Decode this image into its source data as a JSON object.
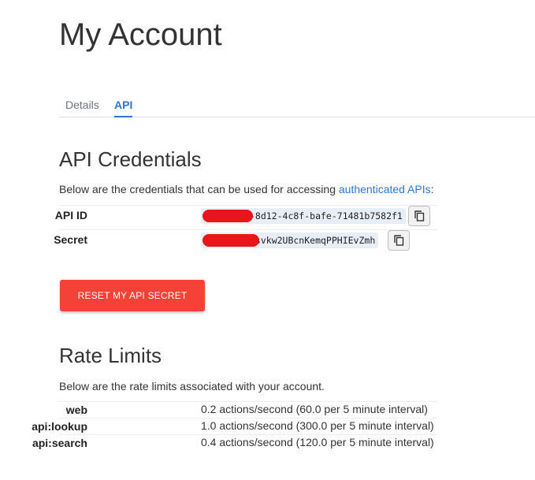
{
  "page": {
    "title": "My Account"
  },
  "tabs": [
    {
      "label": "Details",
      "active": false
    },
    {
      "label": "API",
      "active": true
    }
  ],
  "accent_color": "#2f74d6",
  "credentials": {
    "title": "API Credentials",
    "desc_prefix": "Below are the credentials that can be used for accessing ",
    "desc_link": "authenticated APIs",
    "desc_suffix": ":",
    "rows": [
      {
        "label": "API ID",
        "value": "-8d12-4c8f-bafe-71481b7582f1",
        "icon": "copy-icon"
      },
      {
        "label": "Secret",
        "value": "ksvkw2UBcnKemqPPHIEvZmh",
        "icon": "copy-icon"
      }
    ],
    "redaction_color": "#e8151b"
  },
  "reset_button": {
    "label": "RESET MY API SECRET",
    "color": "#f44336"
  },
  "rate_limits": {
    "title": "Rate Limits",
    "desc": "Below are the rate limits associated with your account.",
    "rows": [
      {
        "label": "web",
        "value": "0.2 actions/second (60.0 per 5 minute interval)"
      },
      {
        "label": "api:lookup",
        "value": "1.0 actions/second (300.0 per 5 minute interval)"
      },
      {
        "label": "api:search",
        "value": "0.4 actions/second (120.0 per 5 minute interval)"
      }
    ]
  }
}
